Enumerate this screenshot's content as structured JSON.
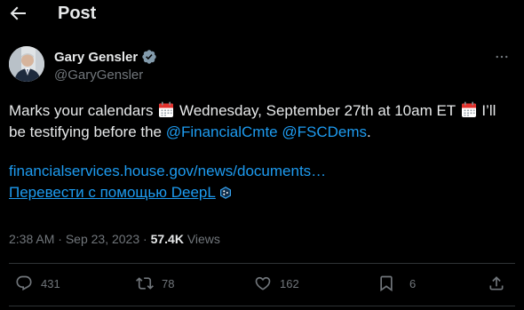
{
  "header": {
    "title": "Post",
    "back_icon": "arrow-left-icon"
  },
  "author": {
    "display_name": "Gary Gensler",
    "handle": "@GaryGensler",
    "verified_icon": "verified-badge-icon",
    "verified_color": "#829aab"
  },
  "tweet": {
    "text_1": "Marks your calendars",
    "text_2": " Wednesday, September 27th at 10am ET ",
    "text_3": " I’ll be testifying before the ",
    "mention_1": "@FinancialCmte",
    "mention_2": "@FSCDems",
    "text_4": ".",
    "link": "financialservices.house.gov/news/documents…",
    "translate_label": "Перевести с помощью DeepL",
    "emoji_icon": "calendar-icon"
  },
  "meta": {
    "time": "2:38 AM",
    "separator": " · ",
    "date": "Sep 23, 2023",
    "views_count": "57.4K",
    "views_label": " Views"
  },
  "actions": {
    "reply_count": "431",
    "repost_count": "78",
    "like_count": "162",
    "bookmark_count": "6"
  },
  "colors": {
    "background": "#000000",
    "text": "#e7e9ea",
    "muted": "#71767b",
    "link": "#1d9bf0",
    "divider": "#2f3336"
  }
}
